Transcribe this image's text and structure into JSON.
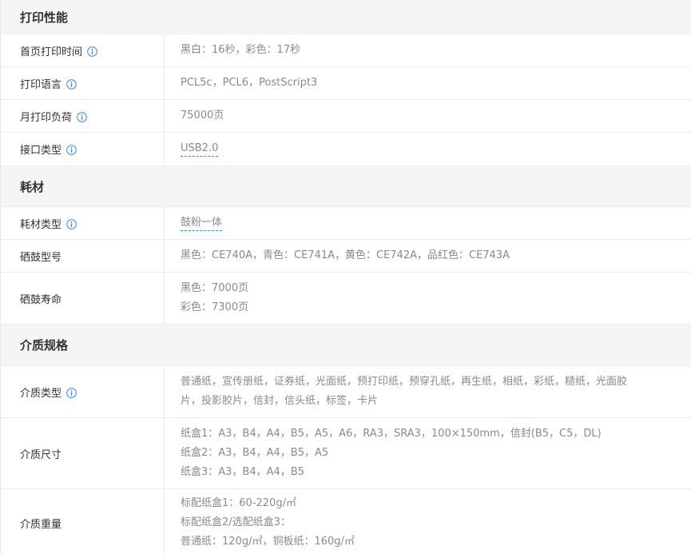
{
  "sections": [
    {
      "title": "打印性能",
      "rows": [
        {
          "label": "首页打印时间",
          "info": true,
          "lines": [
            "黑白：16秒，彩色：17秒"
          ]
        },
        {
          "label": "打印语言",
          "info": true,
          "lines": [
            "PCL5c，PCL6，PostScript3"
          ]
        },
        {
          "label": "月打印负荷",
          "info": true,
          "lines": [
            "75000页"
          ]
        },
        {
          "label": "接口类型",
          "info": true,
          "lines": [
            "USB2.0"
          ],
          "dashed": true
        }
      ]
    },
    {
      "title": "耗材",
      "rows": [
        {
          "label": "耗材类型",
          "info": true,
          "lines": [
            "鼓粉一体"
          ],
          "dashed": true
        },
        {
          "label": "硒鼓型号",
          "info": false,
          "lines": [
            "黑色：CE740A，青色：CE741A，黄色：CE742A，品红色：CE743A"
          ]
        },
        {
          "label": "硒鼓寿命",
          "info": false,
          "lines": [
            "黑色：7000页",
            "彩色：7300页"
          ]
        }
      ]
    },
    {
      "title": "介质规格",
      "rows": [
        {
          "label": "介质类型",
          "info": true,
          "lines": [
            "普通纸，宣传册纸，证券纸，光面纸，预打印纸，预穿孔纸，再生纸，相纸，彩纸，糙纸，光面胶",
            "片，投影胶片，信封，信头纸，标签，卡片"
          ]
        },
        {
          "label": "介质尺寸",
          "info": false,
          "lines": [
            "纸盒1：A3，B4，A4，B5，A5，A6，RA3，SRA3，100×150mm，信封(B5，C5，DL)",
            "纸盒2：A3，B4，A4，B5，A5",
            "纸盒3：A3，B4，A4，B5"
          ]
        },
        {
          "label": "介质重量",
          "info": false,
          "lines": [
            "标配纸盒1：60-220g/㎡",
            "标配纸盒2/选配纸盒3：",
            "普通纸：120g/㎡，铜板纸：160g/㎡"
          ]
        }
      ]
    }
  ],
  "colors": {
    "info_icon": "#3a86e0",
    "label_text": "#333333",
    "value_text": "#8a8a8a",
    "header_bg": "#f5f5f5"
  }
}
